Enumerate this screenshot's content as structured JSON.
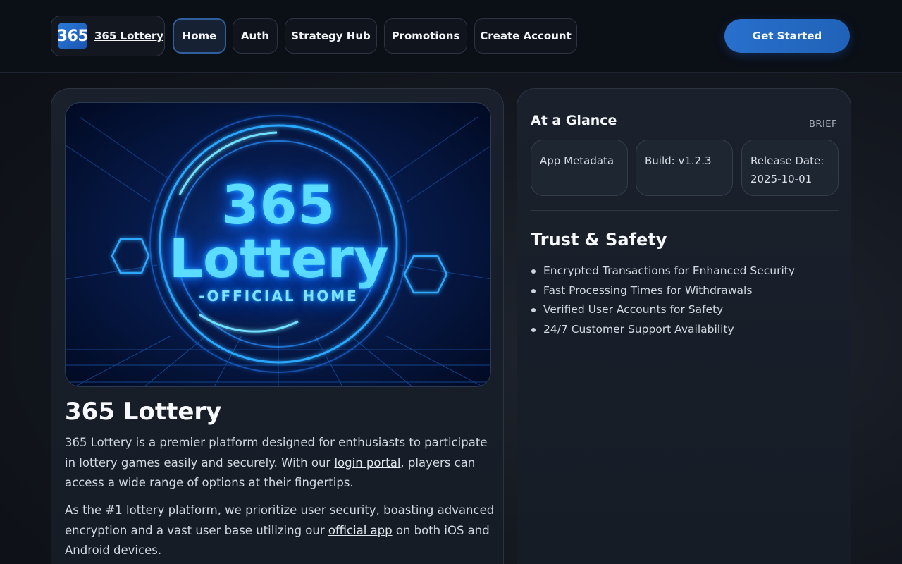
{
  "header": {
    "brand_logo_text": "365",
    "brand_name": "365 Lottery",
    "nav": [
      "Home",
      "Auth",
      "Strategy Hub",
      "Promotions",
      "Create Account"
    ],
    "active_nav": "Home",
    "cta_label": "Get Started"
  },
  "hero": {
    "title_line1": "365",
    "title_line2": "Lottery",
    "subtitle": "-OFFICIAL HOME"
  },
  "main": {
    "title": "365 Lottery",
    "paragraph1_before": "365 Lottery is a premier platform designed for enthusiasts to participate in lottery games easily and securely. With our ",
    "paragraph1_link": "login portal",
    "paragraph1_after": ", players can access a wide range of options at their fingertips.",
    "paragraph2_before": "As the #1 lottery platform, we prioritize user security, boasting advanced encryption and a vast user base utilizing our ",
    "paragraph2_link": "official app",
    "paragraph2_after": " on both iOS and Android devices."
  },
  "glance": {
    "title": "At a Glance",
    "tag": "BRIEF",
    "pills": [
      "App Metadata",
      "Build: v1.2.3",
      "Release Date: 2025-10-01"
    ]
  },
  "trust": {
    "title": "Trust & Safety",
    "items": [
      "Encrypted Transactions for Enhanced Security",
      "Fast Processing Times for Withdrawals",
      "Verified User Accounts for Safety",
      "24/7 Customer Support Availability"
    ]
  },
  "colors": {
    "accent": "#2870cc",
    "background": "#0b0f16",
    "neon": "#3fd0ff"
  }
}
